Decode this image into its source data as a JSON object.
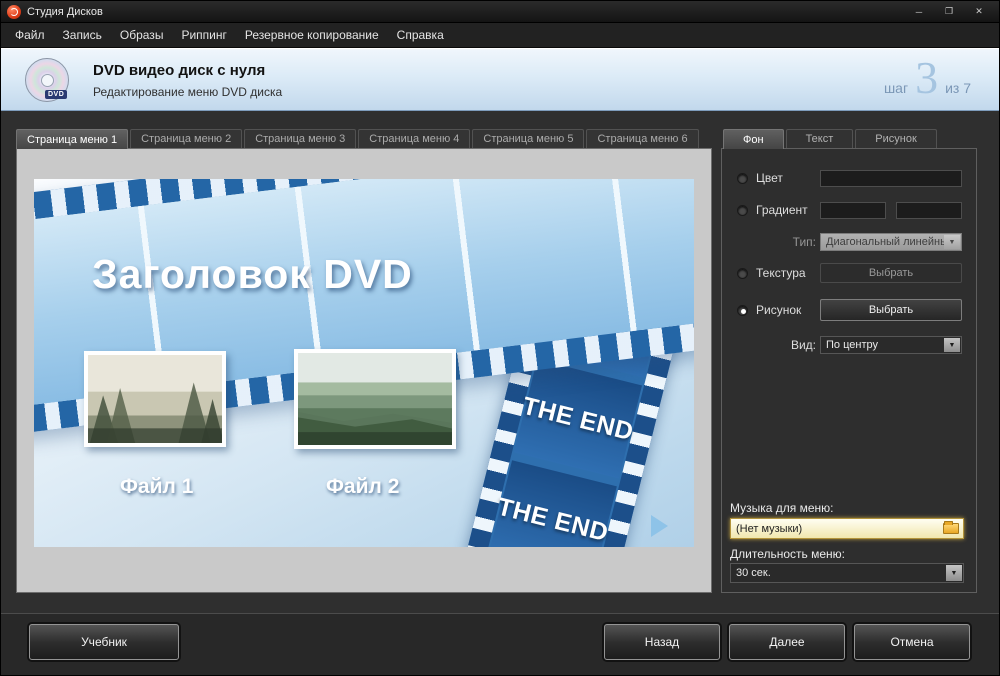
{
  "window": {
    "title": "Студия Дисков",
    "controls": {
      "minimize": "─",
      "maximize": "❐",
      "close": "✕"
    }
  },
  "menubar": {
    "items": [
      "Файл",
      "Запись",
      "Образы",
      "Риппинг",
      "Резервное копирование",
      "Справка"
    ]
  },
  "header": {
    "title": "DVD видео диск с нуля",
    "subtitle": "Редактирование меню DVD диска",
    "disc_icon_text": "DVD",
    "step": {
      "prefix": "шаг",
      "number": "3",
      "suffix": "из 7"
    }
  },
  "page_tabs": {
    "items": [
      "Страница меню 1",
      "Страница меню 2",
      "Страница меню 3",
      "Страница меню 4",
      "Страница меню 5",
      "Страница меню 6"
    ],
    "active": "Страница меню 1"
  },
  "preview": {
    "menu_title": "Заголовок DVD",
    "file_labels": [
      "Файл 1",
      "Файл 2"
    ],
    "film_text": "THE END"
  },
  "panel": {
    "tabs": [
      "Фон",
      "Текст",
      "Рисунок"
    ],
    "active_tab": "Фон",
    "color_label": "Цвет",
    "gradient_label": "Градиент",
    "type_label": "Тип:",
    "type_value": "Диагональный линейный",
    "texture_label": "Текстура",
    "texture_button": "Выбрать",
    "picture_label": "Рисунок",
    "picture_button": "Выбрать",
    "selected_option": "Рисунок",
    "view_label": "Вид:",
    "view_value": "По центру",
    "music_label": "Музыка для меню:",
    "music_value": "(Нет музыки)",
    "duration_label": "Длительность меню:",
    "duration_value": "30 сек."
  },
  "footer": {
    "tutorial": "Учебник",
    "back": "Назад",
    "next": "Далее",
    "cancel": "Отмена"
  },
  "icons": {
    "dropdown_arrow": "▼"
  },
  "colors": {
    "header_bg_top": "#f0f6fc",
    "header_bg_bottom": "#c2d8ec",
    "step_number": "#a5c4e0",
    "film_blue": "#2e6fae",
    "music_field_glow": "#ebc346",
    "panel_bg": "#2e2e2e"
  }
}
